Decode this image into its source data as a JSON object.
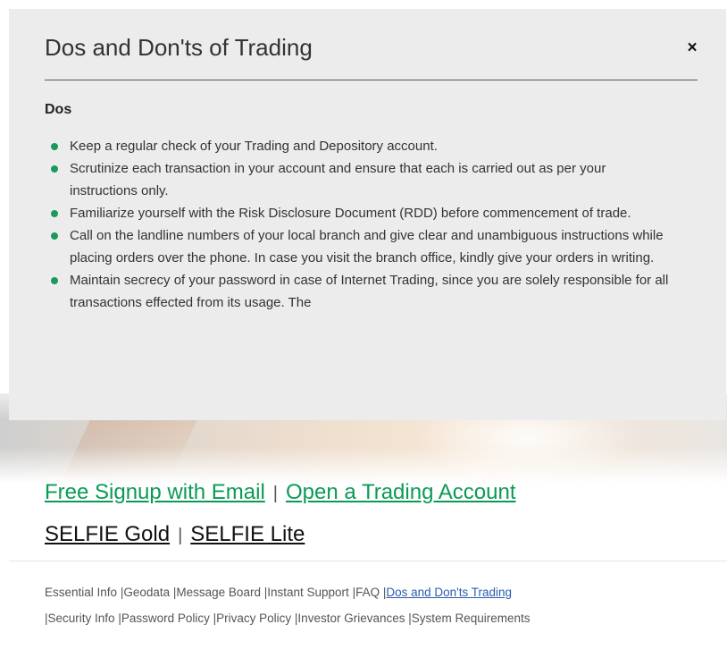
{
  "modal": {
    "title": "Dos and Don'ts of Trading",
    "close_icon": "×",
    "section_heading": "Dos",
    "dos_items": [
      "Keep a regular check of your Trading and Depository account.",
      "Scrutinize each transaction in your account and ensure that each is carried out as per your instructions only.",
      "Familiarize yourself with the Risk Disclosure Document (RDD) before commencement of trade.",
      "Call on the landline numbers of your local branch and give clear and unambiguous instructions while placing orders over the phone. In case you visit the branch office, kindly give your orders in writing.",
      "Maintain secrecy of your password in case of Internet Trading, since you are solely responsible for all transactions effected from its usage. The"
    ]
  },
  "cta": {
    "signup_label": "Free Signup with Email",
    "separator": "|",
    "open_account_label": "Open a Trading Account"
  },
  "products": {
    "gold_label": "SELFIE Gold",
    "separator": "|",
    "lite_label": "SELFIE Lite"
  },
  "footer": {
    "links": [
      "Essential Info",
      "|Geodata",
      "|Message Board",
      "|Instant Support",
      "|FAQ",
      "|",
      "Dos and Don'ts Trading",
      "|Security Info",
      "|Password Policy",
      "|Privacy Policy",
      "|Investor Grievances",
      "|System Requirements"
    ]
  },
  "colors": {
    "accent_green": "#0b9a55",
    "bullet_green": "#1a9a5a",
    "active_link": "#2a5db0",
    "modal_bg": "#ececec"
  }
}
